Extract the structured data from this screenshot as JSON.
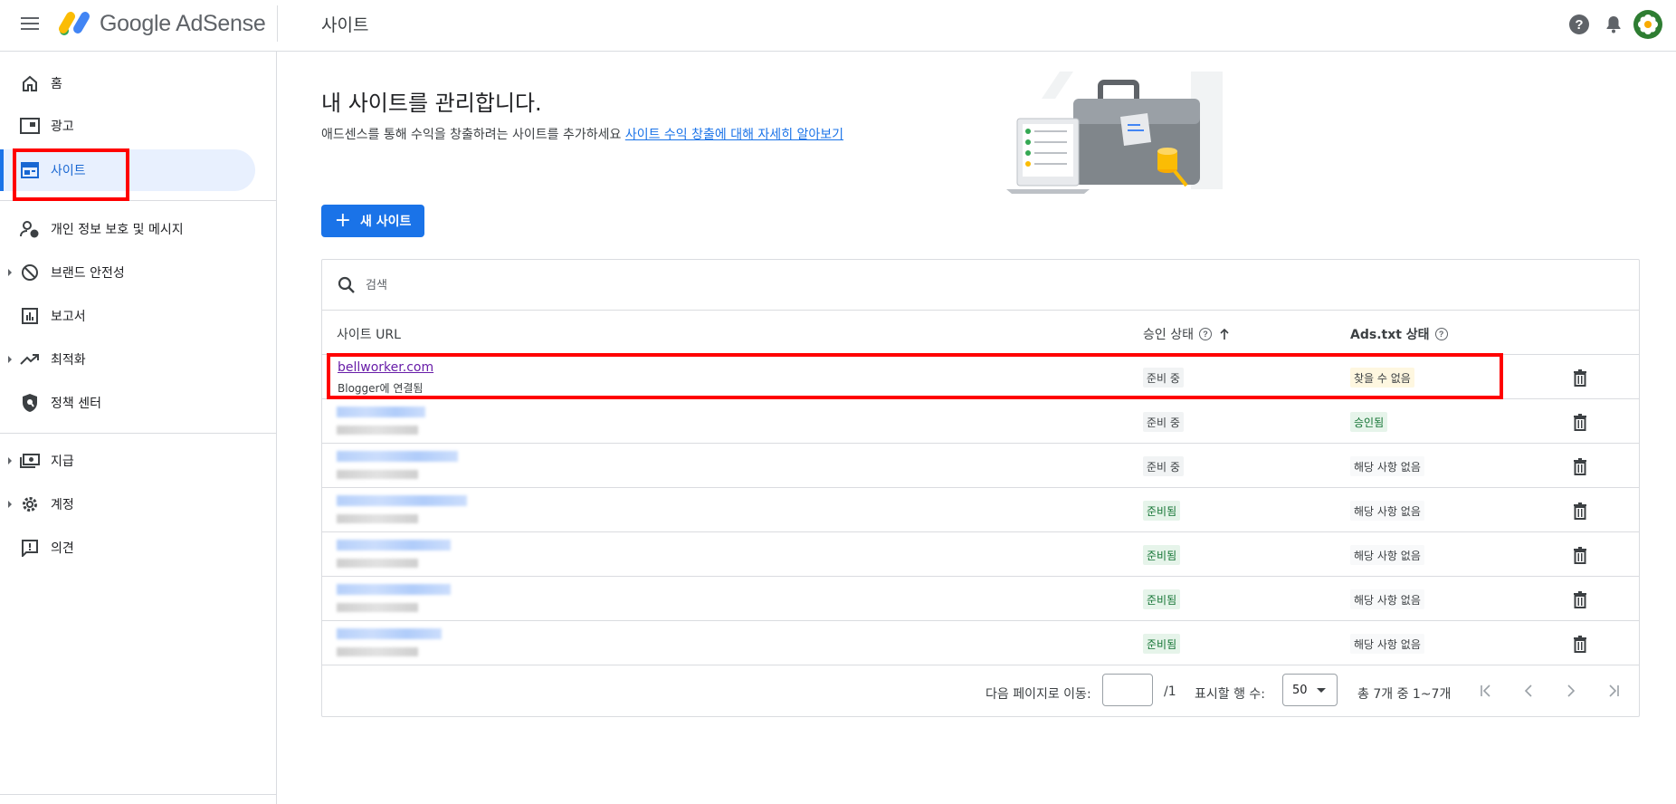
{
  "app": {
    "brand": "Google AdSense",
    "page_title": "사이트"
  },
  "sidebar": {
    "items": [
      {
        "label": "홈",
        "icon": "home-icon"
      },
      {
        "label": "광고",
        "icon": "ads-icon"
      },
      {
        "label": "사이트",
        "icon": "sites-icon",
        "active": true
      },
      {
        "label": "개인 정보 보호 및 메시지",
        "icon": "privacy-messaging-icon"
      },
      {
        "label": "브랜드 안전성",
        "icon": "block-icon",
        "expandable": true
      },
      {
        "label": "보고서",
        "icon": "reports-icon"
      },
      {
        "label": "최적화",
        "icon": "trending-icon",
        "expandable": true
      },
      {
        "label": "정책 센터",
        "icon": "policy-shield-icon"
      },
      {
        "label": "지급",
        "icon": "payments-icon",
        "expandable": true
      },
      {
        "label": "계정",
        "icon": "gear-icon",
        "expandable": true
      },
      {
        "label": "의견",
        "icon": "feedback-icon"
      }
    ]
  },
  "main": {
    "heading": "내 사이트를 관리합니다.",
    "subtitle": "애드센스를 통해 수익을 창출하려는 사이트를 추가하세요",
    "learn_more": "사이트 수익 창출에 대해 자세히 알아보기",
    "new_site_button": "새 사이트"
  },
  "table": {
    "search_placeholder": "검색",
    "columns": {
      "url": "사이트 URL",
      "approval": "승인 상태",
      "ads_txt": "Ads.txt 상태"
    },
    "rows": [
      {
        "url": "bellworker.com",
        "sub": "Blogger에 연결됨",
        "approval": "준비 중",
        "ads_txt": "찾을 수 없음"
      },
      {
        "approval": "준비 중",
        "ads_txt": "승인됨"
      },
      {
        "approval": "준비 중",
        "ads_txt": "해당 사항 없음"
      },
      {
        "approval": "준비됨",
        "ads_txt": "해당 사항 없음"
      },
      {
        "approval": "준비됨",
        "ads_txt": "해당 사항 없음"
      },
      {
        "approval": "준비됨",
        "ads_txt": "해당 사항 없음"
      },
      {
        "approval": "준비됨",
        "ads_txt": "해당 사항 없음"
      }
    ]
  },
  "pagination": {
    "goto_label": "다음 페이지로 이동:",
    "page_value": "",
    "page_total": "/1",
    "rows_label": "표시할 행 수:",
    "rows_value": "50",
    "summary": "총 7개 중 1~7개"
  },
  "colors": {
    "accent": "#1a73e8",
    "highlight_box": "#ff0000"
  }
}
